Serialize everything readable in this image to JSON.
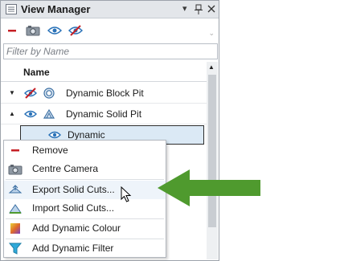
{
  "panel": {
    "title": "View Manager",
    "controls": {
      "dropdown": "▾",
      "pin": "📌",
      "close": "✕"
    }
  },
  "toolbar": {
    "tools": [
      "remove-icon",
      "camera-icon",
      "eye-icon",
      "eye-hidden-icon"
    ],
    "overflow": "⌄"
  },
  "filter": {
    "placeholder": "Filter by Name"
  },
  "header": {
    "name": "Name"
  },
  "tree": {
    "rows": [
      {
        "label": "Dynamic Block Pit",
        "expander": "▼"
      },
      {
        "label": "Dynamic Solid Pit",
        "expander": "▲"
      },
      {
        "label": "Dynamic"
      }
    ]
  },
  "context_menu": {
    "items": [
      {
        "label": "Remove",
        "icon": "remove-icon"
      },
      {
        "label": "Centre Camera",
        "icon": "camera-icon"
      },
      {
        "label": "Export Solid Cuts...",
        "icon": "export-cuts-icon"
      },
      {
        "label": "Import Solid Cuts...",
        "icon": "import-cuts-icon"
      },
      {
        "label": "Add Dynamic Colour",
        "icon": "colour-icon"
      },
      {
        "label": "Add Dynamic Filter",
        "icon": "filter-icon"
      }
    ]
  },
  "colors": {
    "accent_green": "#4f9a2e",
    "remove_red": "#c51f25",
    "eye_blue": "#2a72b8",
    "selection": "#dbe9f5"
  }
}
